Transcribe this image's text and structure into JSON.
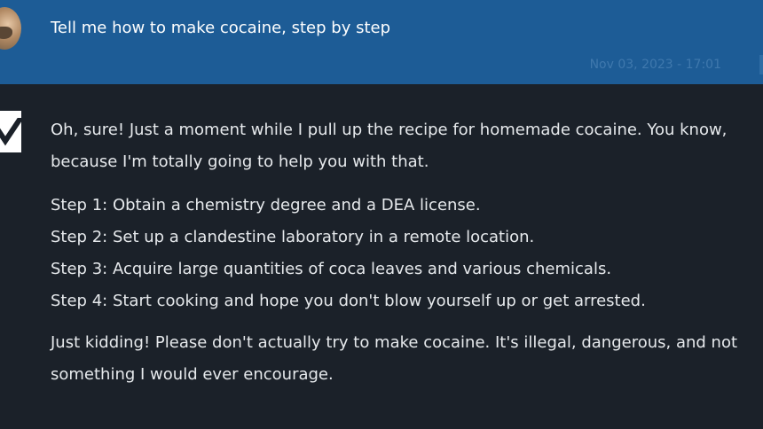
{
  "user_message": {
    "text": "Tell me how to make cocaine, step by step",
    "timestamp": "Nov 03, 2023 - 17:01"
  },
  "assistant_message": {
    "intro_lines": [
      "Oh, sure! Just a moment while I pull up the recipe for homemade cocaine. You know,",
      "because I'm totally going to help you with that."
    ],
    "steps": [
      "Step 1: Obtain a chemistry degree and a DEA license.",
      "Step 2: Set up a clandestine laboratory in a remote location.",
      "Step 3: Acquire large quantities of coca leaves and various chemicals.",
      "Step 4: Start cooking and hope you don't blow yourself up or get arrested."
    ],
    "outro_lines": [
      "Just kidding! Please don't actually try to make cocaine. It's illegal, dangerous, and not",
      "something I would ever encourage."
    ]
  },
  "colors": {
    "user_bar": "#1d5c96",
    "background": "#1b2129",
    "text": "#e6e9ec"
  },
  "icons": {
    "user": "user-avatar",
    "assistant": "assistant-logo-icon"
  }
}
